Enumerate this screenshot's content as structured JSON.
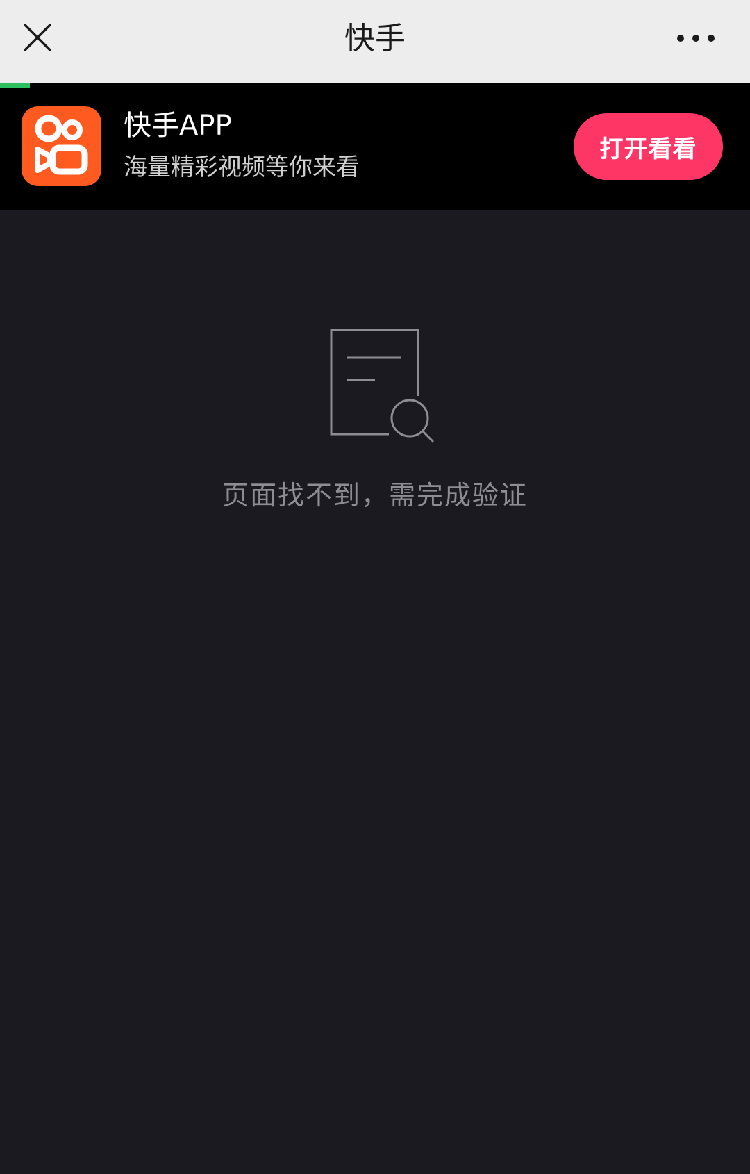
{
  "nav": {
    "title": "快手",
    "close_icon": "close-icon",
    "more_icon": "more-dots-icon",
    "progress": 0.04
  },
  "banner": {
    "app_name": "快手APP",
    "slogan": "海量精彩视频等你来看",
    "open_label": "打开看看",
    "logo_icon": "kuaishou-logo-icon"
  },
  "main": {
    "empty_icon": "document-search-icon",
    "message": "页面找不到，需完成验证"
  },
  "colors": {
    "nav_bg": "#ededed",
    "banner_bg": "#000000",
    "page_bg": "#1b1a20",
    "brand_orange": "#ff5a1f",
    "open_button": "#fe3666",
    "progress": "#2dbf5f",
    "message_text": "#8e8e92"
  }
}
